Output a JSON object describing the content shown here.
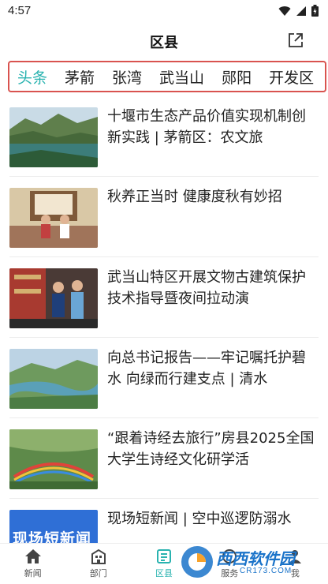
{
  "status": {
    "time": "4:57"
  },
  "header": {
    "title": "区县"
  },
  "tabs": [
    {
      "label": "头条",
      "active": true
    },
    {
      "label": "茅箭",
      "active": false
    },
    {
      "label": "张湾",
      "active": false
    },
    {
      "label": "武当山",
      "active": false
    },
    {
      "label": "郧阳",
      "active": false
    },
    {
      "label": "开发区",
      "active": false
    }
  ],
  "news": [
    {
      "title": "十堰市生态产品价值实现机制创新实践 | 茅箭区：农文旅"
    },
    {
      "title": "秋养正当时 健康度秋有妙招"
    },
    {
      "title": "武当山特区开展文物古建筑保护技术指导暨夜间拉动演"
    },
    {
      "title": "向总书记报告——牢记嘱托护碧水 向绿而行建支点 | 清水"
    },
    {
      "title": "“跟着诗经去旅行”房县2025全国大学生诗经文化研学活"
    },
    {
      "title": "现场短新闻 | 空中巡逻防溺水"
    }
  ],
  "thumb_text": {
    "news_brand": "现场短新闻"
  },
  "tabbar": [
    {
      "label": "新闻",
      "icon": "home-icon",
      "active": false
    },
    {
      "label": "部门",
      "icon": "building-icon",
      "active": false
    },
    {
      "label": "区县",
      "icon": "county-icon",
      "active": true
    },
    {
      "label": "服务",
      "icon": "service-icon",
      "active": false
    },
    {
      "label": "我",
      "icon": "profile-icon",
      "active": false
    }
  ],
  "watermark": {
    "logo": "西西软件园",
    "url": "CR173.COM"
  },
  "colors": {
    "accent": "#2ab3b0",
    "highlight_border": "#d9534f"
  }
}
